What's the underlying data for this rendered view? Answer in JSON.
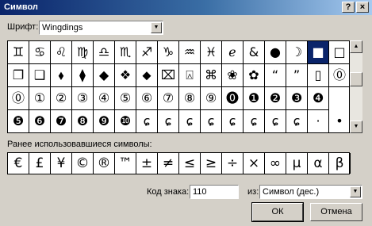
{
  "window": {
    "title": "Символ",
    "help_glyph": "?",
    "close_glyph": "×"
  },
  "font": {
    "label": "Шрифт:",
    "value": "Wingdings"
  },
  "symbols": {
    "rows": [
      [
        "♊",
        "♋",
        "♌",
        "♍",
        "♎",
        "♏",
        "♐",
        "♑",
        "♒",
        "♓",
        "ℯ",
        "&",
        "●",
        "☽",
        "■",
        "□"
      ],
      [
        "❐",
        "❑",
        "⬧",
        "⧫",
        "◆",
        "❖",
        "⬥",
        "⌧",
        "⍓",
        "⌘",
        "❀",
        "✿",
        "“",
        "”",
        "▯",
        "⓪"
      ],
      [
        "⓪",
        "①",
        "②",
        "③",
        "④",
        "⑤",
        "⑥",
        "⑦",
        "⑧",
        "⑨",
        "⓿",
        "❶",
        "❷",
        "❸",
        "❹"
      ],
      [
        "❺",
        "❻",
        "❼",
        "❽",
        "❾",
        "❿",
        "ɕ",
        "ɕ",
        "ɕ",
        "ɕ",
        "ɕ",
        "ɕ",
        "ɕ",
        "ɕ",
        "·",
        "•"
      ]
    ],
    "selected_row": 0,
    "selected_col": 14
  },
  "recent": {
    "label": "Ранее использовавшиеся символы:",
    "items": [
      "€",
      "£",
      "¥",
      "©",
      "®",
      "™",
      "±",
      "≠",
      "≤",
      "≥",
      "÷",
      "×",
      "∞",
      "μ",
      "α",
      "β"
    ]
  },
  "char_code": {
    "label": "Код знака:",
    "value": "110"
  },
  "from": {
    "label": "из:",
    "value": "Символ (дес.)"
  },
  "buttons": {
    "ok": "ОК",
    "cancel": "Отмена"
  },
  "scroll": {
    "up": "▲",
    "down": "▼"
  }
}
